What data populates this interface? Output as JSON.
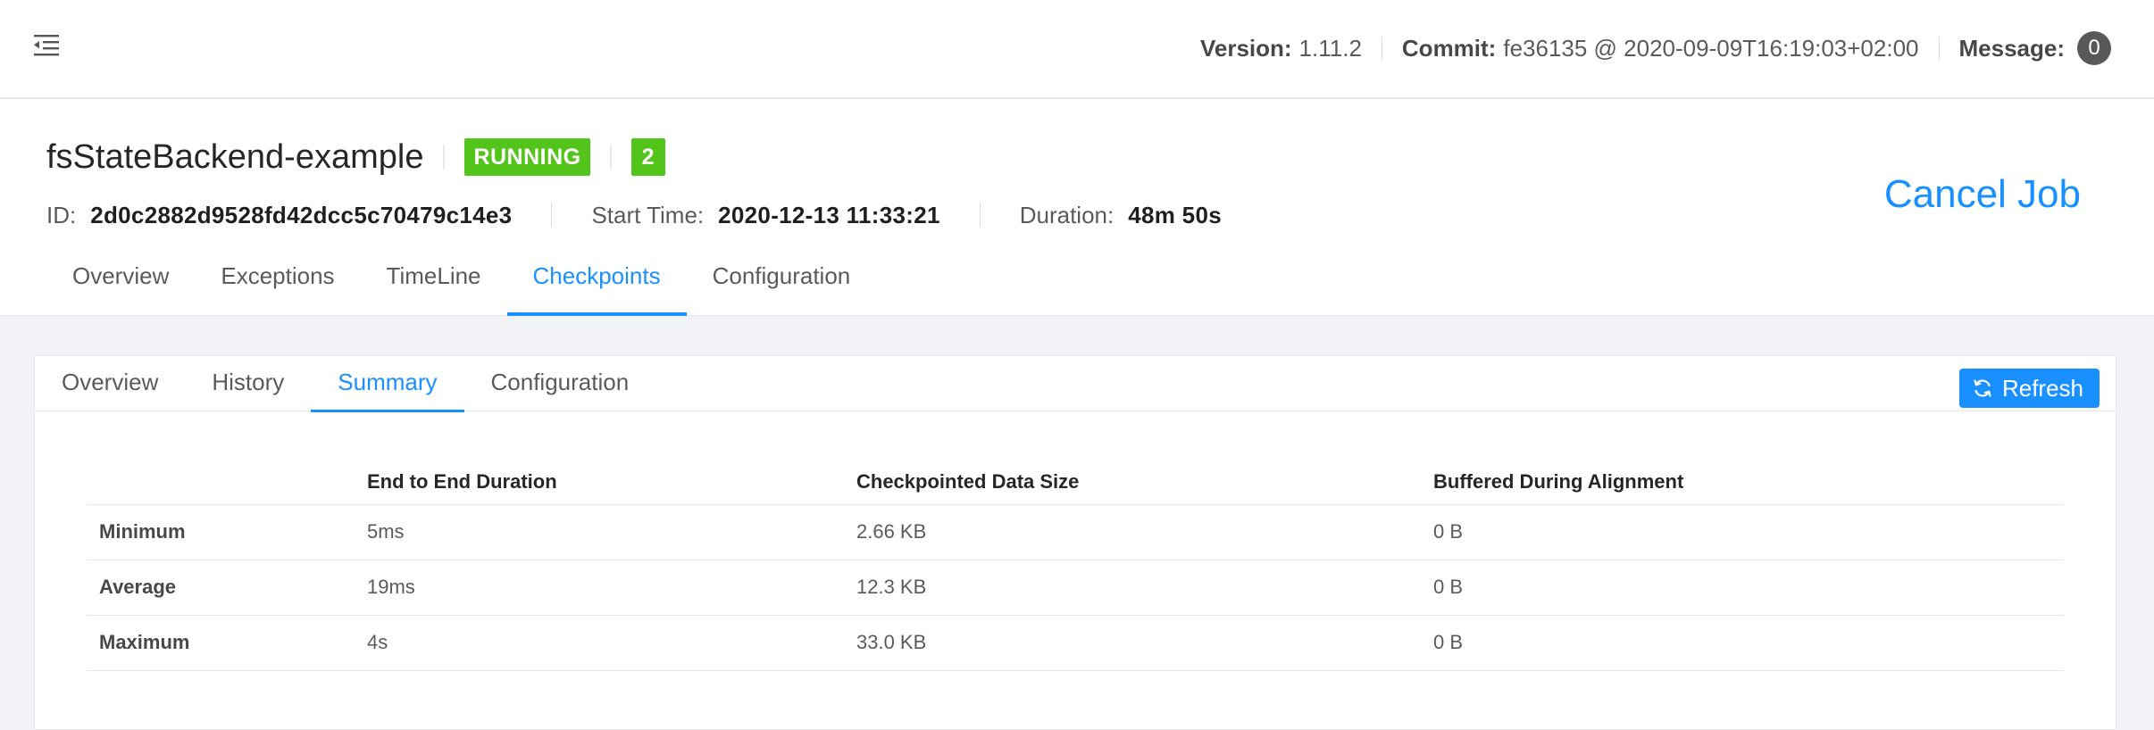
{
  "topbar": {
    "menu_icon": "menu-fold-icon",
    "version_label": "Version:",
    "version_value": "1.11.2",
    "commit_label": "Commit:",
    "commit_value": "fe36135 @ 2020-09-09T16:19:03+02:00",
    "message_label": "Message:",
    "message_count": "0"
  },
  "job": {
    "name": "fsStateBackend-example",
    "status": "RUNNING",
    "task_count": "2",
    "id_label": "ID:",
    "id_value": "2d0c2882d9528fd42dcc5c70479c14e3",
    "start_label": "Start Time:",
    "start_value": "2020-12-13 11:33:21",
    "duration_label": "Duration:",
    "duration_value": "48m 50s",
    "cancel_label": "Cancel Job",
    "tabs": [
      {
        "label": "Overview"
      },
      {
        "label": "Exceptions"
      },
      {
        "label": "TimeLine"
      },
      {
        "label": "Checkpoints"
      },
      {
        "label": "Configuration"
      }
    ],
    "active_tab": "Checkpoints"
  },
  "checkpoints": {
    "tabs": [
      {
        "label": "Overview"
      },
      {
        "label": "History"
      },
      {
        "label": "Summary"
      },
      {
        "label": "Configuration"
      }
    ],
    "active_tab": "Summary",
    "refresh_label": "Refresh",
    "refresh_icon": "sync-icon",
    "table": {
      "headers": [
        "",
        "End to End Duration",
        "Checkpointed Data Size",
        "Buffered During Alignment"
      ],
      "rows": [
        [
          "Minimum",
          "5ms",
          "2.66 KB",
          "0 B"
        ],
        [
          "Average",
          "19ms",
          "12.3 KB",
          "0 B"
        ],
        [
          "Maximum",
          "4s",
          "33.0 KB",
          "0 B"
        ]
      ]
    }
  },
  "colors": {
    "accent": "#1890ff",
    "running": "#52c41a",
    "badge": "#595959"
  }
}
